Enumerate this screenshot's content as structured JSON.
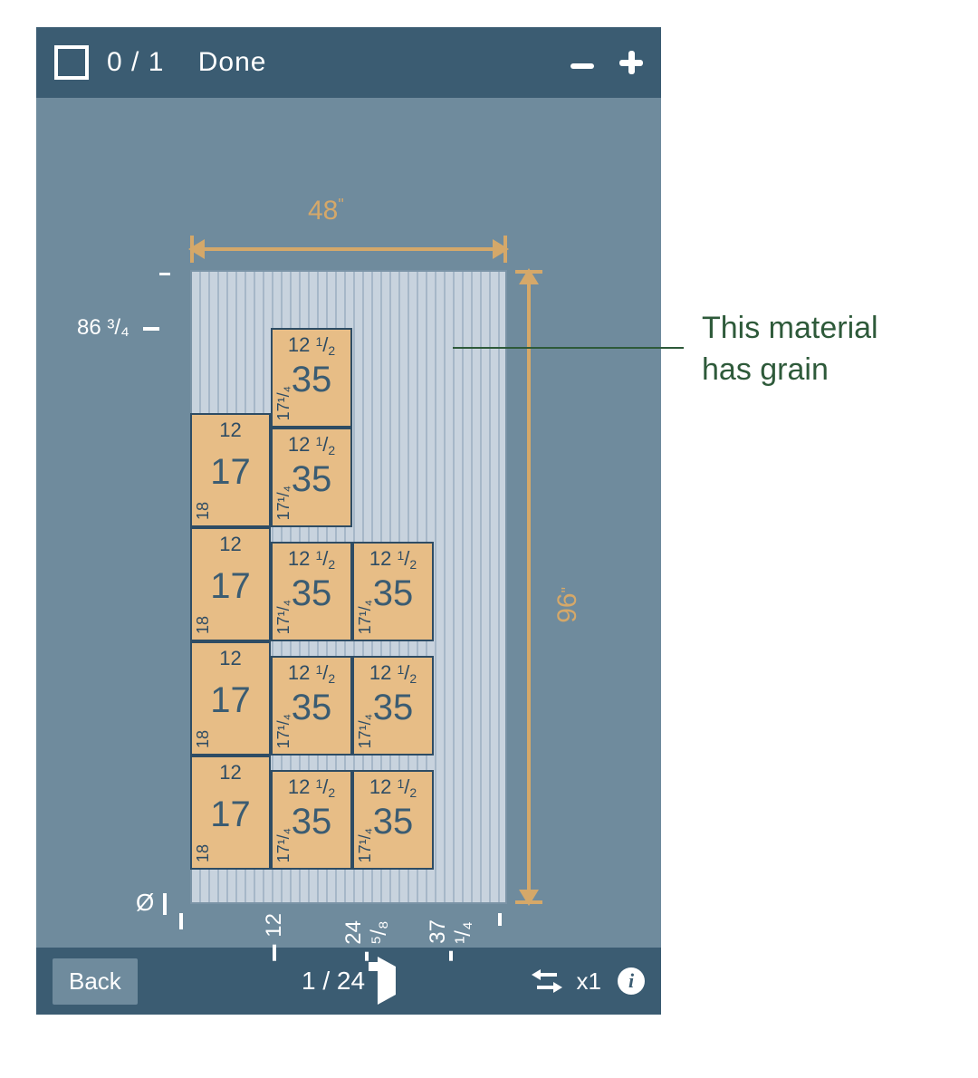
{
  "topbar": {
    "progress": "0 / 1",
    "done_label": "Done"
  },
  "bottombar": {
    "back_label": "Back",
    "page": "1 / 24",
    "quantity": "x1"
  },
  "sheet": {
    "width_label": "48",
    "height_label": "96",
    "unit": "\""
  },
  "y_ticks": {
    "waste": "86 ³/₄",
    "zero": "Ø"
  },
  "x_ticks": {
    "t12": "12",
    "t24_58": "24 ⁵/₈",
    "t37_14": "37 ¹/₄"
  },
  "pieces": {
    "colA": {
      "top": "12",
      "side": "18",
      "center": "17"
    },
    "colB": {
      "top_int": "12",
      "top_sup": "1",
      "top_sub": "2",
      "side": "17¹/₄",
      "center": "35"
    }
  },
  "annotation": {
    "line1": "This material",
    "line2": "has grain"
  }
}
